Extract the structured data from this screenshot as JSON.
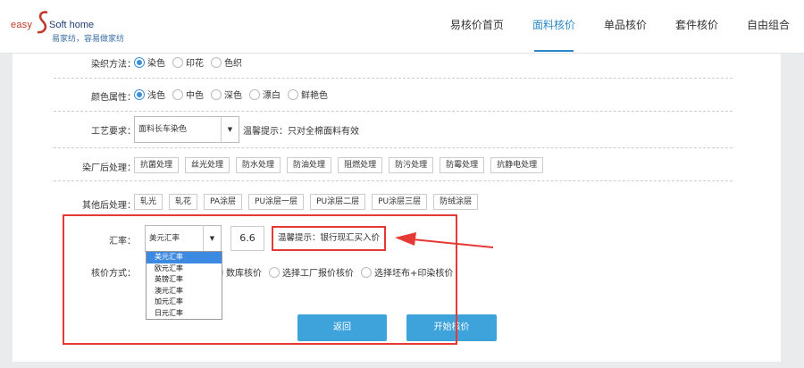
{
  "logo": {
    "brand": "easy",
    "brand2": "Soft home",
    "slogan": "易家纺，容易做家纺"
  },
  "nav": [
    {
      "label": "易核价首页",
      "active": false
    },
    {
      "label": "面料核价",
      "active": true
    },
    {
      "label": "单品核价",
      "active": false
    },
    {
      "label": "套件核价",
      "active": false
    },
    {
      "label": "自由组合",
      "active": false
    }
  ],
  "form": {
    "dyeing": {
      "label": "染织方法：",
      "options": [
        "染色",
        "印花",
        "色织"
      ],
      "selected": "染色"
    },
    "color": {
      "label": "颜色属性：",
      "options": [
        "浅色",
        "中色",
        "深色",
        "漂白",
        "鲜艳色"
      ],
      "selected": "浅色"
    },
    "process": {
      "label": "工艺要求：",
      "value": "面料长车染色",
      "tip": "温馨提示：只对全棉面料有效"
    },
    "post_dye": {
      "label": "染厂后处理：",
      "tags": [
        "抗菌处理",
        "丝光处理",
        "防水处理",
        "防油处理",
        "阻燃处理",
        "防污处理",
        "防霉处理",
        "抗静电处理"
      ]
    },
    "other": {
      "label": "其他后处理：",
      "tags": [
        "轧光",
        "轧花",
        "PA涂层",
        "PU涂层一层",
        "PU涂层二层",
        "PU涂层三层",
        "防绒涂层"
      ]
    },
    "rate": {
      "label": "汇率：",
      "value": "美元汇率",
      "amount": "6.6",
      "tip": "温馨提示：银行现汇买入价"
    },
    "rate_options": [
      "美元汇率",
      "欧元汇率",
      "英镑汇率",
      "澳元汇率",
      "加元汇率",
      "日元汇率"
    ],
    "method": {
      "label": "核价方式：",
      "options": [
        "数库核价",
        "选择工厂报价核价",
        "选择坯布+印染核价"
      ]
    }
  },
  "buttons": {
    "back": "返回",
    "start": "开始核价"
  },
  "colors": {
    "accent": "#3ea2db",
    "annotation": "#e53935",
    "selection": "#3b89e0"
  }
}
